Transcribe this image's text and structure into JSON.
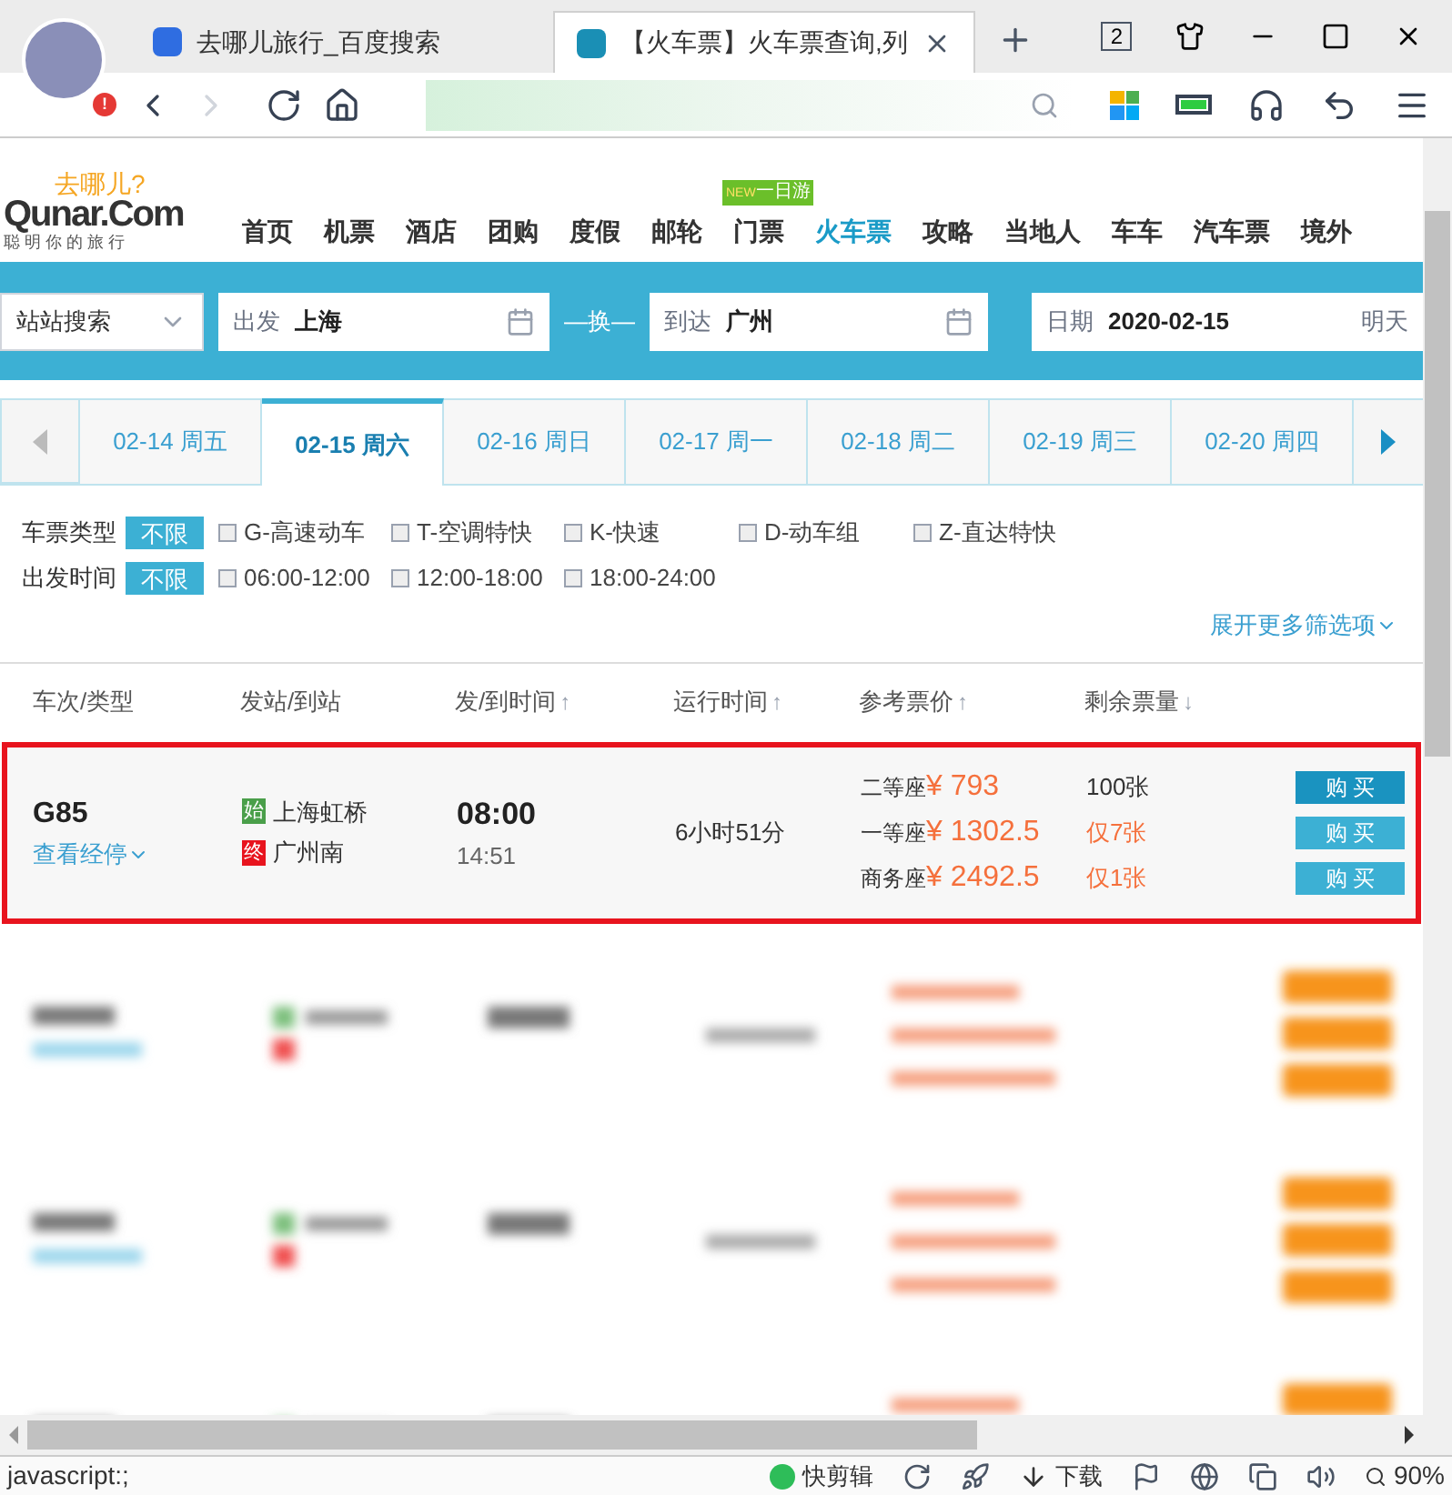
{
  "browser": {
    "tabs": [
      {
        "title": "去哪儿旅行_百度搜索",
        "selected": false
      },
      {
        "title": "【火车票】火车票查询,列",
        "selected": true
      }
    ],
    "alert": "!",
    "window_count": "2"
  },
  "site": {
    "logo_top": "去哪儿?",
    "logo_main": "Qunar.Com",
    "logo_slogan": "聪 明 你 的 旅 行",
    "nav": [
      {
        "label": "首页",
        "selected": false
      },
      {
        "label": "机票",
        "selected": false
      },
      {
        "label": "酒店",
        "selected": false
      },
      {
        "label": "团购",
        "selected": false
      },
      {
        "label": "度假",
        "selected": false
      },
      {
        "label": "邮轮",
        "selected": false
      },
      {
        "label": "门票",
        "selected": false,
        "badge_new": "NEW",
        "badge": "一日游"
      },
      {
        "label": "火车票",
        "selected": true
      },
      {
        "label": "攻略",
        "selected": false
      },
      {
        "label": "当地人",
        "selected": false
      },
      {
        "label": "车车",
        "selected": false
      },
      {
        "label": "汽车票",
        "selected": false
      },
      {
        "label": "境外",
        "selected": false
      }
    ]
  },
  "search": {
    "mode": "站站搜索",
    "from_label": "出发",
    "from": "上海",
    "swap": "—换—",
    "to_label": "到达",
    "to": "广州",
    "date_label": "日期",
    "date": "2020-02-15",
    "date_hint": "明天"
  },
  "dates": [
    {
      "label": "02-14 周五",
      "selected": false
    },
    {
      "label": "02-15 周六",
      "selected": true
    },
    {
      "label": "02-16 周日",
      "selected": false
    },
    {
      "label": "02-17 周一",
      "selected": false
    },
    {
      "label": "02-18 周二",
      "selected": false
    },
    {
      "label": "02-19 周三",
      "selected": false
    },
    {
      "label": "02-20 周四",
      "selected": false
    }
  ],
  "filters": [
    {
      "label": "车票类型",
      "all": "不限",
      "options": [
        {
          "label": "G-高速动车",
          "checked": false
        },
        {
          "label": "T-空调特快",
          "checked": false
        },
        {
          "label": "K-快速",
          "checked": false
        },
        {
          "label": "D-动车组",
          "checked": false
        },
        {
          "label": "Z-直达特快",
          "checked": false
        }
      ]
    },
    {
      "label": "出发时间",
      "all": "不限",
      "options": [
        {
          "label": "06:00-12:00",
          "checked": false
        },
        {
          "label": "12:00-18:00",
          "checked": false
        },
        {
          "label": "18:00-24:00",
          "checked": false
        }
      ]
    }
  ],
  "more_filters": "展开更多筛选项",
  "columns": [
    {
      "label": "车次/类型"
    },
    {
      "label": "发站/到站"
    },
    {
      "label": "发/到时间",
      "sort": "↑"
    },
    {
      "label": "运行时间",
      "sort": "↑"
    },
    {
      "label": "参考票价",
      "sort": "↑"
    },
    {
      "label": "剩余票量",
      "sort": "↓"
    }
  ],
  "train": {
    "highlighted": true,
    "number": "G85",
    "stops_link": "查看经停",
    "from_tag": "始",
    "from": "上海虹桥",
    "to_tag": "终",
    "to": "广州南",
    "depart": "08:00",
    "arrive": "14:51",
    "duration": "6小时51分",
    "seats": [
      {
        "class": "二等座",
        "price": "¥ 793",
        "remaining": "100张",
        "scarce": false,
        "buy": "购 买",
        "selected": true
      },
      {
        "class": "一等座",
        "price": "¥ 1302.5",
        "remaining": "仅7张",
        "scarce": true,
        "buy": "购 买",
        "selected": false
      },
      {
        "class": "商务座",
        "price": "¥ 2492.5",
        "remaining": "仅1张",
        "scarce": true,
        "buy": "购 买",
        "selected": false
      }
    ]
  },
  "status_bar": {
    "url": "javascript:;",
    "clip": "快剪辑",
    "download": "下载",
    "zoom": "90%"
  }
}
